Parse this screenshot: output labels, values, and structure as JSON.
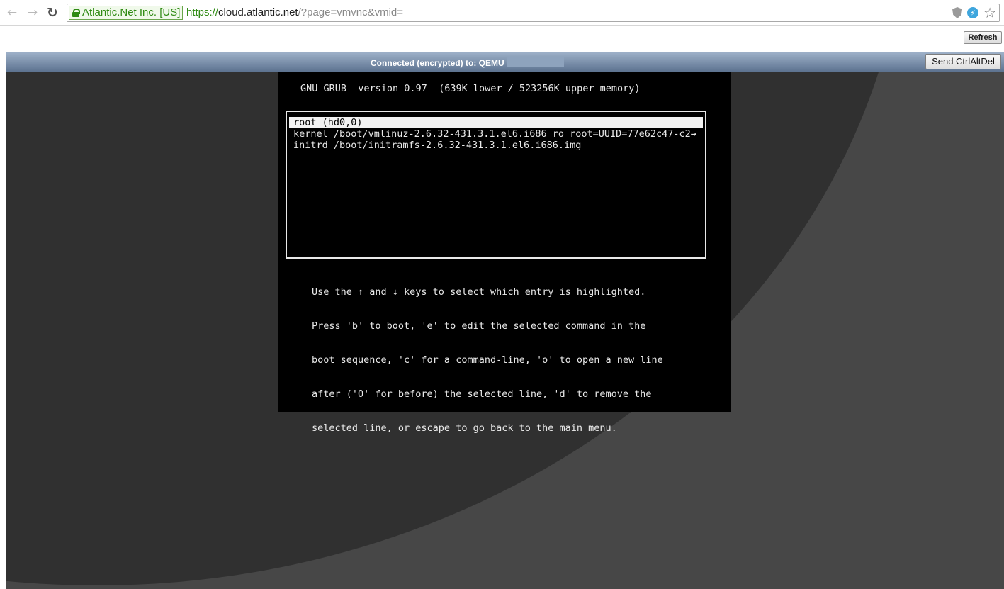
{
  "browser": {
    "ev_label": "Atlantic.Net Inc. [US]",
    "url_scheme": "https://",
    "url_host": "cloud.atlantic.net",
    "url_path": "/?page=vmvnc&vmid=",
    "back_glyph": "←",
    "forward_glyph": "→",
    "reload_glyph": "↻",
    "star_glyph": "☆",
    "icons": [
      "lock-icon",
      "shield-icon",
      "extension-icon",
      "star-icon"
    ]
  },
  "toolbar": {
    "refresh_label": "Refresh"
  },
  "vnc": {
    "status_text": "Connected (encrypted) to: QEMU",
    "ctrlaltdel_label": "Send CtrlAltDel"
  },
  "grub": {
    "header": "GNU GRUB  version 0.97  (639K lower / 523256K upper memory)",
    "entries": [
      "root (hd0,0)",
      "kernel /boot/vmlinuz-2.6.32-431.3.1.el6.i686 ro root=UUID=77e62c47-c2→",
      "initrd /boot/initramfs-2.6.32-431.3.1.el6.i686.img"
    ],
    "selected_index": 0,
    "help": [
      "Use the ↑ and ↓ keys to select which entry is highlighted.",
      "Press 'b' to boot, 'e' to edit the selected command in the",
      "boot sequence, 'c' for a command-line, 'o' to open a new line",
      "after ('O' for before) the selected line, 'd' to remove the",
      "selected line, or escape to go back to the main menu."
    ]
  },
  "colors": {
    "ev_green": "#2e8a13",
    "status_bar_top": "#9db0c8",
    "status_bar_bottom": "#5d7390",
    "vnc_bg": "#474747",
    "screen_bg": "#000000",
    "screen_fg": "#e8e8e8"
  }
}
